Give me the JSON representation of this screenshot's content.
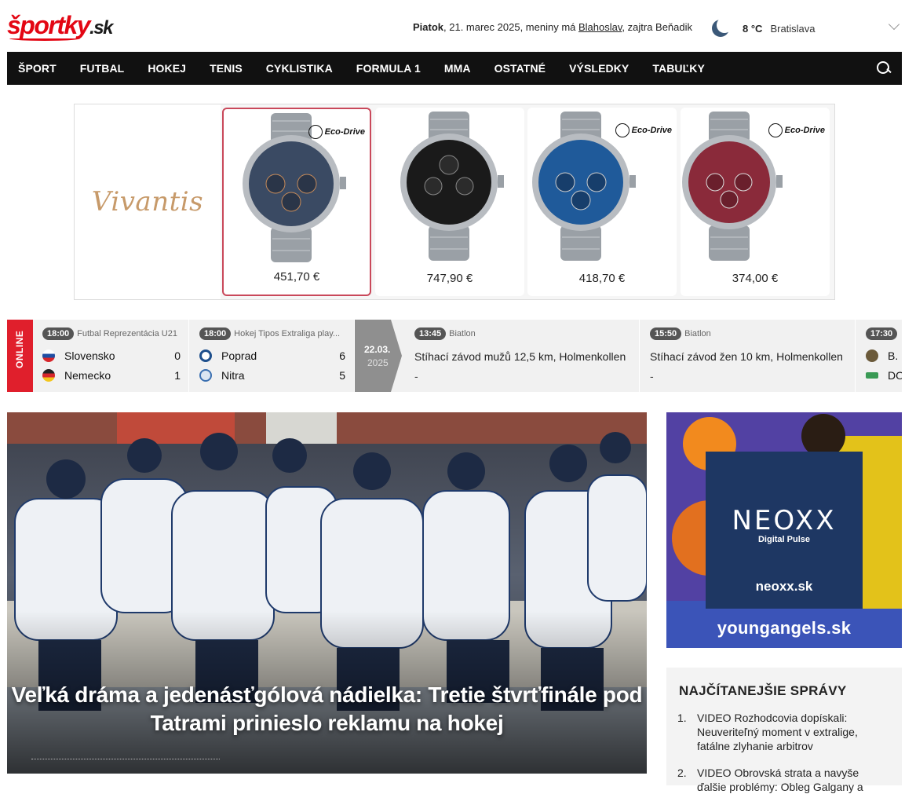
{
  "header": {
    "logo": {
      "part1": "športky",
      "part2": ".sk"
    },
    "date": {
      "day": "Piatok",
      "rest": ", 21. marec 2025, meniny má ",
      "nameday": "Blahoslav",
      "tomorrow": ", zajtra Beňadik"
    },
    "weather": {
      "temp": "8 °C",
      "city": "Bratislava",
      "icon": "moon-icon"
    }
  },
  "nav": {
    "items": [
      "ŠPORT",
      "FUTBAL",
      "HOKEJ",
      "TENIS",
      "CYKLISTIKA",
      "FORMULA 1",
      "MMA",
      "OSTATNÉ",
      "VÝSLEDKY",
      "TABUĽKY"
    ]
  },
  "ad": {
    "brand": "Vivantis",
    "badge": "Eco-Drive",
    "watches": [
      {
        "price": "451,70 €",
        "dial": "#3a4a63",
        "selected": true
      },
      {
        "price": "747,90 €",
        "dial": "#1a1a1a",
        "selected": false
      },
      {
        "price": "418,70 €",
        "dial": "#1f5a9a",
        "selected": false
      },
      {
        "price": "374,00 €",
        "dial": "#8a2a3a",
        "selected": false
      }
    ]
  },
  "ticker": {
    "label": "ONLINE",
    "matches": [
      {
        "time": "18:00",
        "competition": "Futbal Reprezentácia U21",
        "home": "Slovensko",
        "away": "Nemecko",
        "home_score": "0",
        "away_score": "1"
      },
      {
        "time": "18:00",
        "competition": "Hokej Tipos Extraliga play...",
        "home": "Poprad",
        "away": "Nitra",
        "home_score": "6",
        "away_score": "5"
      }
    ],
    "date_chip": {
      "date": "22.03.",
      "year": "2025"
    },
    "events": [
      {
        "time": "13:45",
        "sport": "Biatlon",
        "title": "Stíhací závod mužů 12,5 km, Holmenkollen",
        "result": "-"
      },
      {
        "time": "15:50",
        "sport": "Biatlon",
        "title": "Stíhací závod žen 10 km, Holmenkollen",
        "result": "-"
      }
    ],
    "partial": {
      "time": "17:30",
      "t1": "B. L",
      "t2": "DO"
    }
  },
  "hero": {
    "title": "Veľká dráma a jedenásťgólová nádielka: Tretie štvrťfinále pod Tatrami prinieslo reklamu na hokej"
  },
  "side_ad": {
    "brand": "NEOXX",
    "tagline": "Digital Pulse",
    "url": "neoxx.sk",
    "bottom_url": "youngangels.sk"
  },
  "most_read": {
    "title": "NAJČÍTANEJŠIE SPRÁVY",
    "items": [
      {
        "num": "1.",
        "text": "VIDEO Rozhodcovia dopískali: Neuveriteľný moment v extralige, fatálne zlyhanie arbitrov"
      },
      {
        "num": "2.",
        "text": "VIDEO Obrovská strata a navyše ďalšie problémy: Obleg Galgany a"
      }
    ]
  }
}
